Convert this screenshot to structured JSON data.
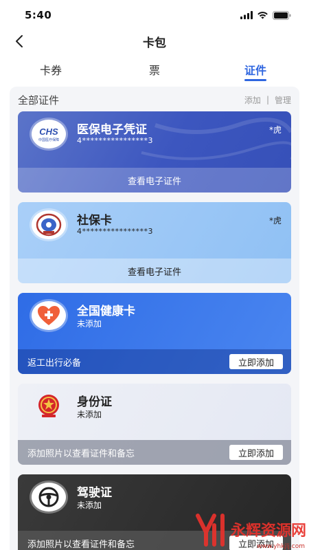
{
  "status_bar": {
    "time": "5:40"
  },
  "nav": {
    "title": "卡包"
  },
  "tabs": [
    {
      "label": "卡券",
      "active": false
    },
    {
      "label": "票",
      "active": false
    },
    {
      "label": "证件",
      "active": true
    }
  ],
  "section": {
    "title": "全部证件",
    "add_label": "添加",
    "separator": "|",
    "manage_label": "管理"
  },
  "cards": {
    "medical": {
      "logo_text": "CHS",
      "logo_subtext": "中国医疗保障",
      "title": "医保电子凭证",
      "number": "4****************3",
      "holder": "*虎",
      "footer": "查看电子证件"
    },
    "social": {
      "title": "社保卡",
      "number": "4****************3",
      "holder": "*虎",
      "footer": "查看电子证件"
    },
    "health": {
      "title": "全国健康卡",
      "status": "未添加",
      "footer_note": "返工出行必备",
      "button": "立即添加"
    },
    "id": {
      "title": "身份证",
      "status": "未添加",
      "footer_note": "添加照片以查看证件和备忘",
      "button": "立即添加"
    },
    "driver": {
      "title": "驾驶证",
      "status": "未添加",
      "footer_note": "添加照片以查看证件和备忘",
      "button": "立即添加"
    }
  },
  "watermark": {
    "text": "永辉资源网",
    "url": "www.yhkjlj.com"
  },
  "colors": {
    "accent": "#2f66e0",
    "watermark": "#e8322c"
  }
}
